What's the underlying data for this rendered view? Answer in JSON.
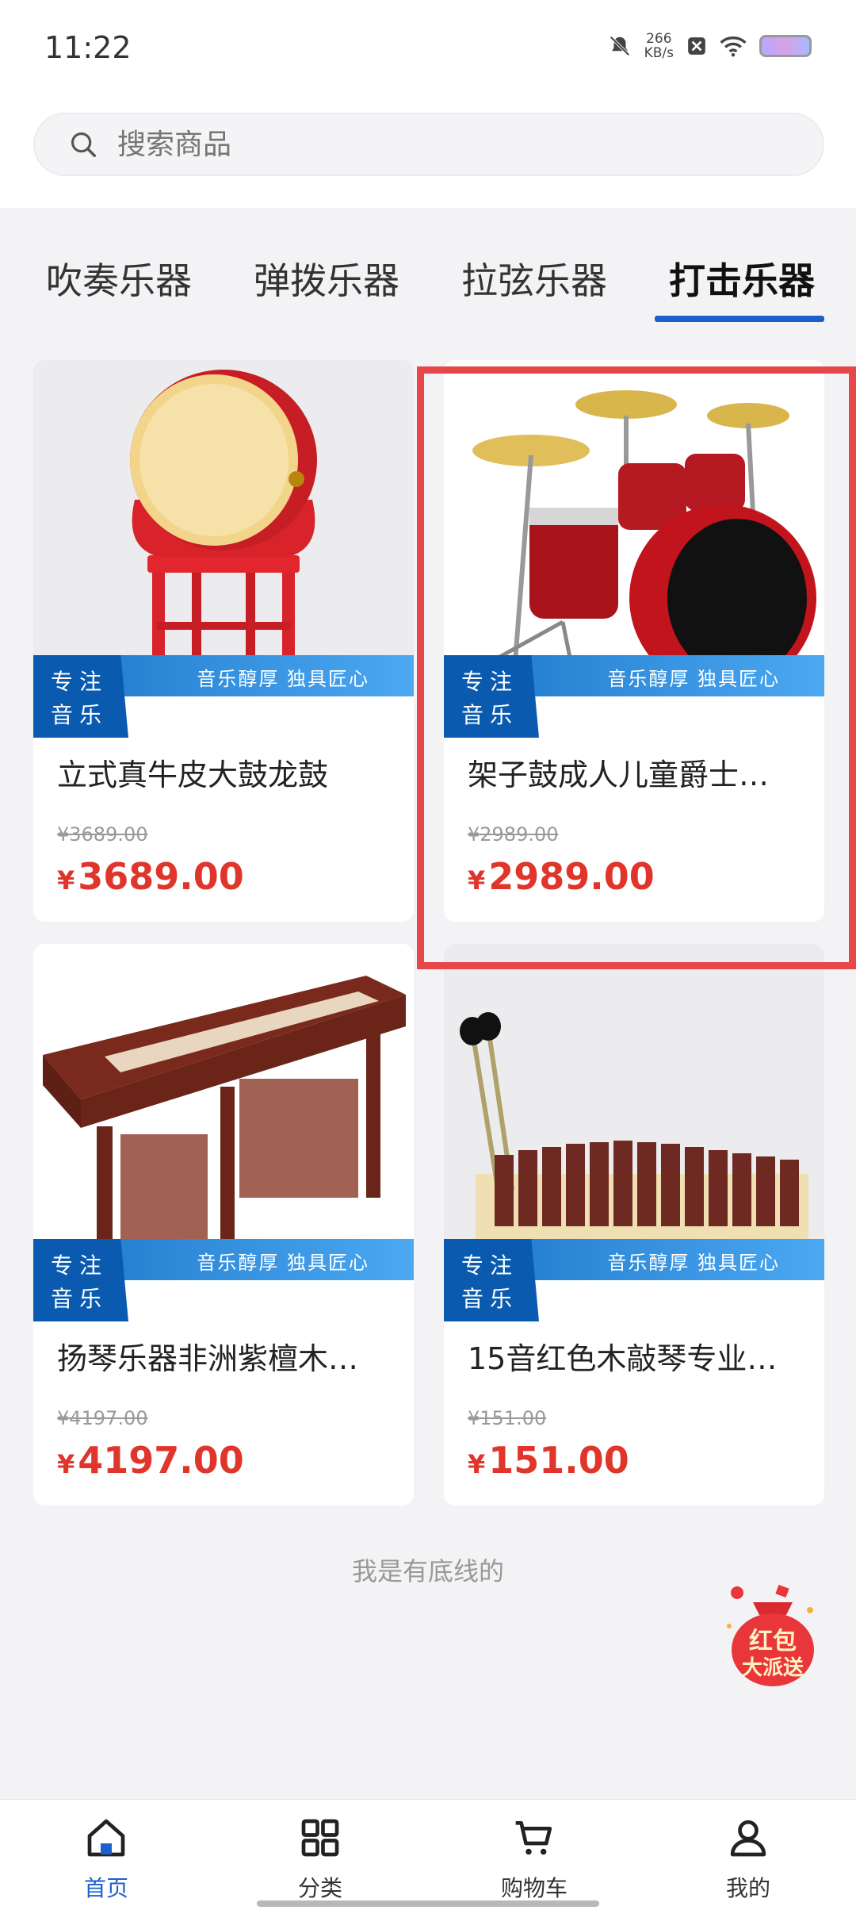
{
  "status_bar": {
    "time": "11:22",
    "speed_value": "266",
    "speed_unit": "KB/s"
  },
  "search": {
    "placeholder": "搜索商品"
  },
  "tabs": [
    {
      "label": "吹奏乐器",
      "active": false
    },
    {
      "label": "弹拨乐器",
      "active": false
    },
    {
      "label": "拉弦乐器",
      "active": false
    },
    {
      "label": "打击乐器",
      "active": true
    }
  ],
  "colors": {
    "accent": "#1e5fce",
    "price": "#e0352b",
    "highlight": "#e8474a",
    "ribbon": "#1d76c9"
  },
  "ribbon": {
    "badge_line1": "专注",
    "badge_line2": "音乐",
    "slogan": "音乐醇厚 独具匠心"
  },
  "products": [
    {
      "title": "立式真牛皮大鼓龙鼓",
      "old_price": "¥3689.00",
      "currency": "¥",
      "price": "3689.00"
    },
    {
      "title": "架子鼓成人儿童爵士…",
      "old_price": "¥2989.00",
      "currency": "¥",
      "price": "2989.00"
    },
    {
      "title": "扬琴乐器非洲紫檀木…",
      "old_price": "¥4197.00",
      "currency": "¥",
      "price": "4197.00"
    },
    {
      "title": "15音红色木敲琴专业…",
      "old_price": "¥151.00",
      "currency": "¥",
      "price": "151.00"
    }
  ],
  "footer_text": "我是有底线的",
  "red_packet": {
    "line1": "红包",
    "line2": "大派送"
  },
  "bottom_nav": [
    {
      "label": "首页",
      "icon": "home-icon",
      "active": true
    },
    {
      "label": "分类",
      "icon": "grid-icon",
      "active": false
    },
    {
      "label": "购物车",
      "icon": "cart-icon",
      "active": false
    },
    {
      "label": "我的",
      "icon": "user-icon",
      "active": false
    }
  ]
}
